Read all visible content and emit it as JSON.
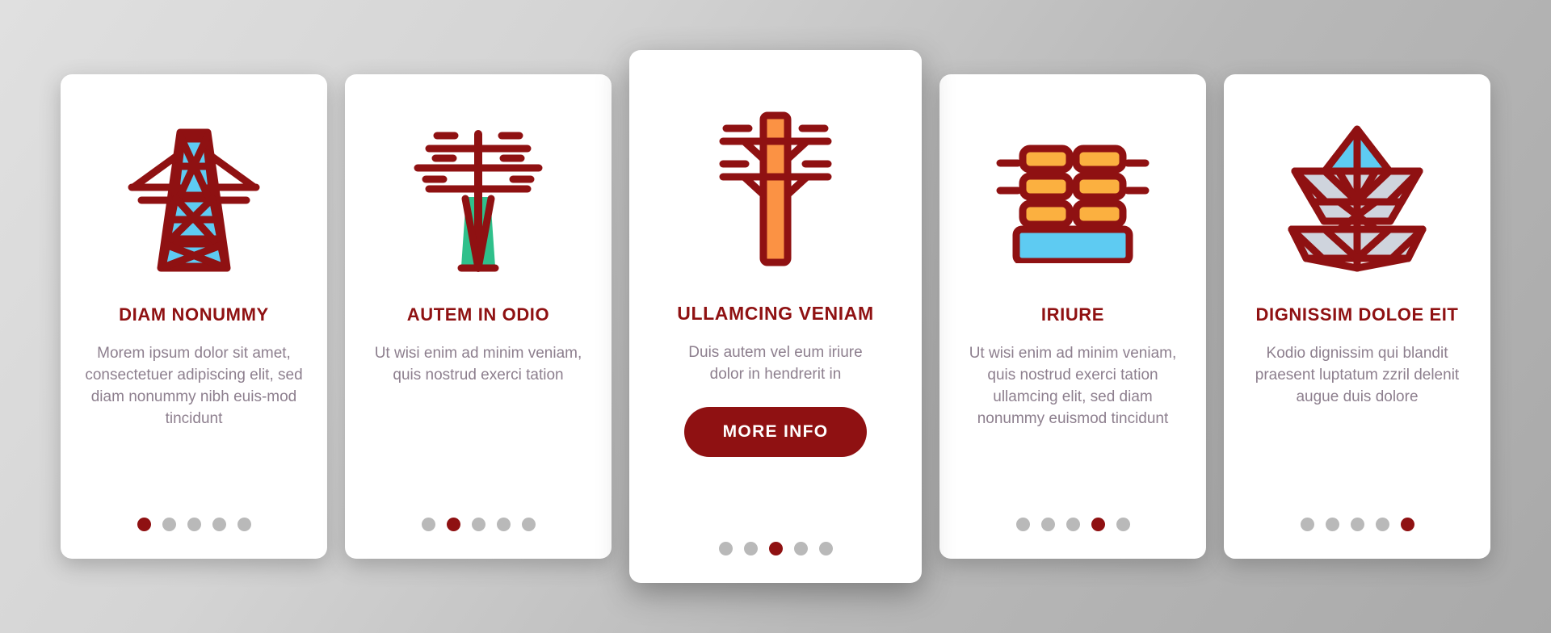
{
  "theme": {
    "accent": "#8f1112",
    "card_bg": "#ffffff",
    "body_text": "#8d7f8e",
    "dot_inactive": "#b9b9b9",
    "page_bg": "#c9c9c9",
    "icon_cyan": "#5ecbf2",
    "icon_grey": "#cfd4dd",
    "icon_green": "#2fc08b",
    "icon_orange": "#fbb040",
    "icon_orange_light": "#fcbf6e"
  },
  "cards": [
    {
      "id": "card-1",
      "icon": "transmission-tower-icon",
      "title": "DIAM NONUMMY",
      "body": "Morem ipsum dolor sit amet, consectetuer adipiscing elit, sed diam nonummy nibh euis-mod tincidunt",
      "dots": 5,
      "active_dot": 1,
      "has_button": false,
      "featured": false
    },
    {
      "id": "card-2",
      "icon": "power-pylon-icon",
      "title": "AUTEM IN ODIO",
      "body": "Ut wisi enim ad minim veniam, quis nostrud exerci tation",
      "dots": 5,
      "active_dot": 2,
      "has_button": false,
      "featured": false
    },
    {
      "id": "card-3",
      "icon": "utility-pole-icon",
      "title": "ULLAMCING VENIAM",
      "body": "Duis autem vel eum iriure dolor in hendrerit in",
      "button_label": "MORE INFO",
      "dots": 5,
      "active_dot": 3,
      "has_button": true,
      "featured": true
    },
    {
      "id": "card-4",
      "icon": "insulator-stack-icon",
      "title": "IRIURE",
      "body": "Ut wisi enim ad minim veniam, quis nostrud exerci tation ullamcing elit, sed diam nonummy euismod tincidunt",
      "dots": 5,
      "active_dot": 4,
      "has_button": false,
      "featured": false
    },
    {
      "id": "card-5",
      "icon": "lattice-tower-icon",
      "title": "DIGNISSIM DOLOE EIT",
      "body": "Kodio dignissim qui blandit praesent luptatum zzril delenit augue duis dolore",
      "dots": 5,
      "active_dot": 5,
      "has_button": false,
      "featured": false
    }
  ]
}
